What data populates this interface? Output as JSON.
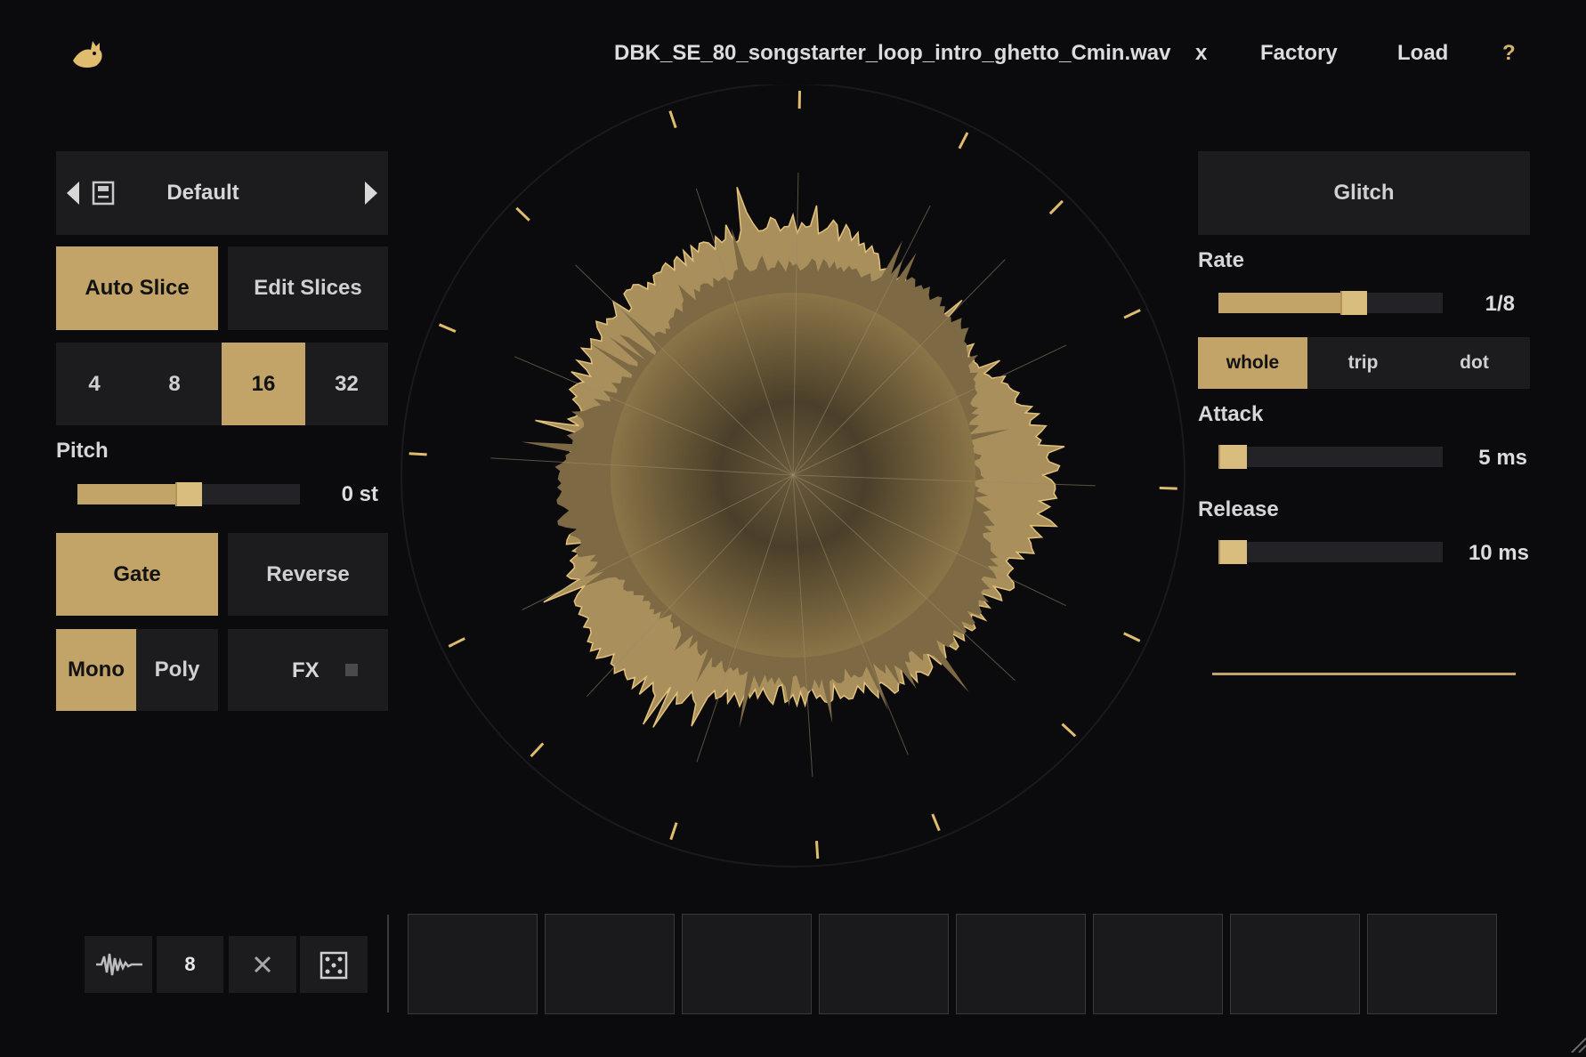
{
  "header": {
    "filename": "DBK_SE_80_songstarter_loop_intro_ghetto_Cmin.wav",
    "close_label": "x",
    "factory_label": "Factory",
    "load_label": "Load",
    "help_label": "?"
  },
  "preset": {
    "name": "Default"
  },
  "slice_mode": {
    "auto_label": "Auto Slice",
    "edit_label": "Edit Slices",
    "active": "auto"
  },
  "slice_counts": {
    "options": [
      "4",
      "8",
      "16",
      "32"
    ],
    "selected": "16"
  },
  "pitch": {
    "label": "Pitch",
    "value_text": "0 st",
    "level": 0.5
  },
  "gate_reverse": {
    "gate_label": "Gate",
    "reverse_label": "Reverse",
    "gate_on": true
  },
  "voice": {
    "mono_label": "Mono",
    "poly_label": "Poly",
    "selected": "mono",
    "fx_label": "FX"
  },
  "effect": {
    "name": "Glitch"
  },
  "rate": {
    "label": "Rate",
    "value_text": "1/8",
    "level": 0.6,
    "modes": [
      "whole",
      "trip",
      "dot"
    ],
    "selected_mode": "whole"
  },
  "attack": {
    "label": "Attack",
    "value_text": "5 ms",
    "level": 0.05
  },
  "release": {
    "label": "Release",
    "value_text": "10 ms",
    "level": 0.05
  },
  "bottom_bar": {
    "count": "8",
    "pad_count": 8
  },
  "colors": {
    "accent": "#c2a468",
    "background": "#0b0b0e",
    "tile": "#1c1c1f"
  },
  "icons": [
    "logo-icon",
    "prev-arrow-icon",
    "save-icon",
    "next-arrow-icon",
    "waveform-icon",
    "clear-icon",
    "dice-icon",
    "resize-grip-icon"
  ]
}
